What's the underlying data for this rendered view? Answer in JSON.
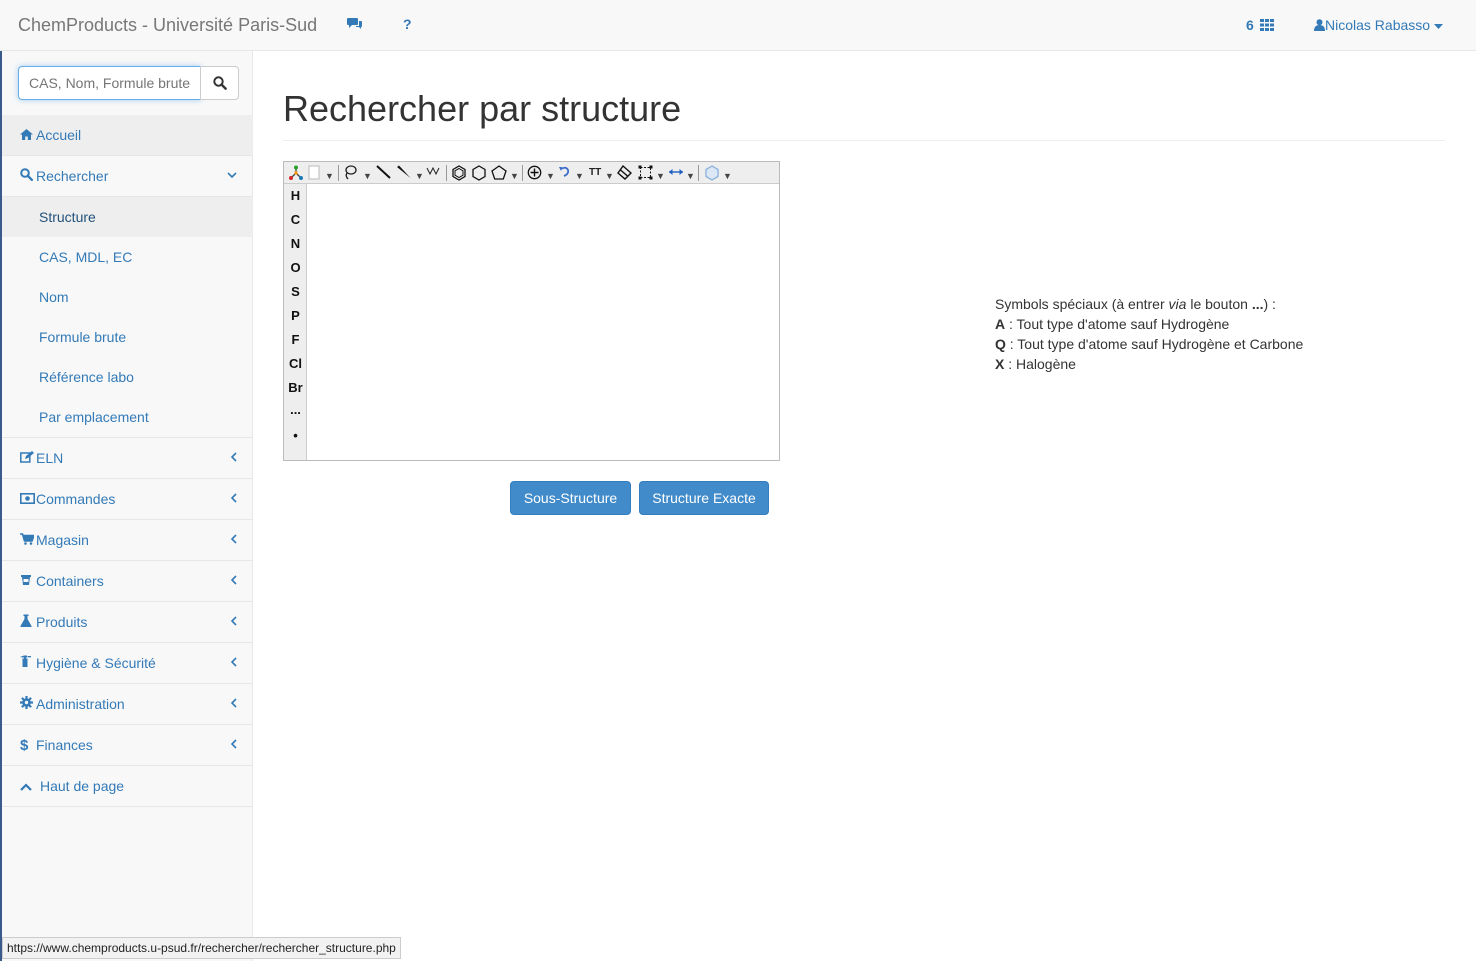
{
  "navbar": {
    "brand": "ChemProducts - Université Paris-Sud",
    "comments_icon": "comments-icon",
    "help_label": "?",
    "count": "6",
    "user": "Nicolas Rabasso"
  },
  "search": {
    "placeholder": "CAS, Nom, Formule brute",
    "value": ""
  },
  "sidebar": {
    "items": [
      {
        "label": "Accueil",
        "icon": "home-icon"
      },
      {
        "label": "Rechercher",
        "icon": "search-icon"
      },
      {
        "label": "ELN",
        "icon": "edit-icon"
      },
      {
        "label": "Commandes",
        "icon": "money-icon"
      },
      {
        "label": "Magasin",
        "icon": "cart-icon"
      },
      {
        "label": "Containers",
        "icon": "container-icon"
      },
      {
        "label": "Produits",
        "icon": "flask-icon"
      },
      {
        "label": "Hygiène & Sécurité",
        "icon": "extinguisher-icon"
      },
      {
        "label": "Administration",
        "icon": "gear-icon"
      },
      {
        "label": "Finances",
        "icon": "dollar-icon"
      },
      {
        "label": "Haut de page",
        "icon": "chevron-up-icon"
      }
    ],
    "sub_items": [
      "Structure",
      "CAS, MDL, EC",
      "Nom",
      "Formule brute",
      "Référence labo",
      "Par emplacement"
    ]
  },
  "main": {
    "title": "Rechercher par structure",
    "atoms": [
      "H",
      "C",
      "N",
      "O",
      "S",
      "P",
      "F",
      "Cl",
      "Br",
      "...",
      "•"
    ],
    "buttons": {
      "sub": "Sous-Structure",
      "exact": "Structure Exacte"
    }
  },
  "info": {
    "intro_pre": "Symbols spéciaux (à entrer ",
    "intro_via": "via",
    "intro_mid": " le bouton ",
    "intro_dots": "...",
    "intro_post": ") :",
    "lines": [
      {
        "key": "A",
        "text": " : Tout type d'atome sauf Hydrogène"
      },
      {
        "key": "Q",
        "text": " : Tout type d'atome sauf Hydrogène et Carbone"
      },
      {
        "key": "X",
        "text": " : Halogène"
      }
    ]
  },
  "status_url": "https://www.chemproducts.u-psud.fr/rechercher/rechercher_structure.php"
}
